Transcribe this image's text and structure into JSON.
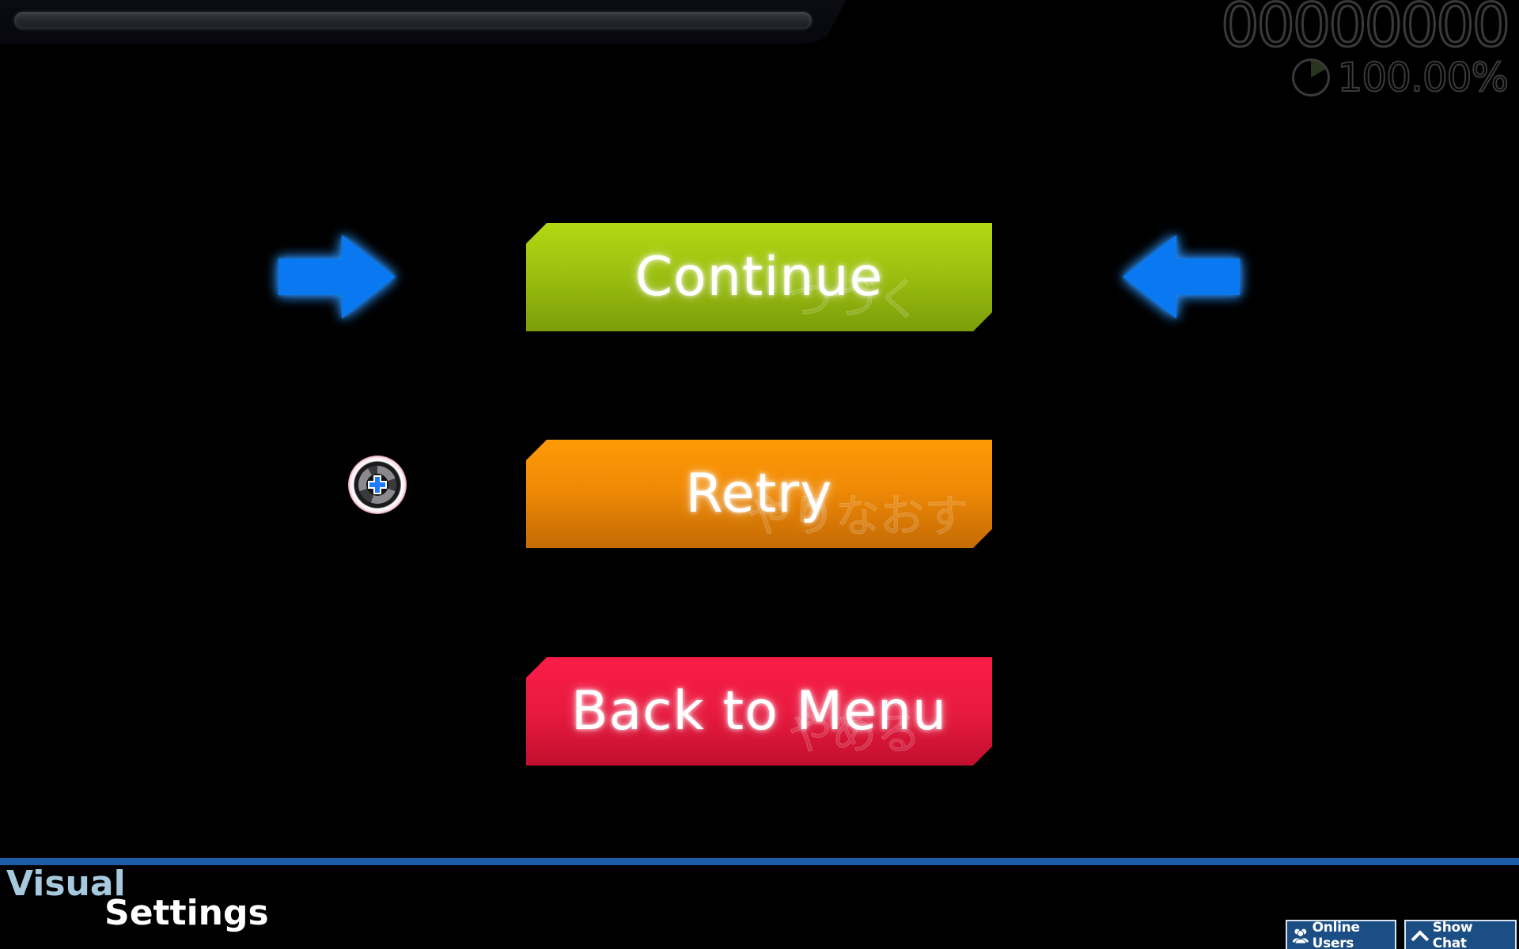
{
  "hud": {
    "score": "00000000",
    "accuracy": "100.00%",
    "health_fraction": 1.0
  },
  "pause_menu": {
    "buttons": [
      {
        "label": "Continue",
        "sub_label": "つづく",
        "color": "#9cc10f"
      },
      {
        "label": "Retry",
        "sub_label": "やりなおす",
        "color": "#f08a06"
      },
      {
        "label": "Back to Menu",
        "sub_label": "やめる",
        "color": "#e81a3f"
      }
    ],
    "selected_index": 0,
    "arrow_color": "#0a78f0"
  },
  "cursor": {
    "icon": "game-cursor-icon"
  },
  "overlay": {
    "title_line1": "Visual",
    "title_line2": "Settings",
    "online_users_label": "Online Users",
    "show_chat_label": "Show Chat",
    "accent_color": "#1a5ea8"
  }
}
